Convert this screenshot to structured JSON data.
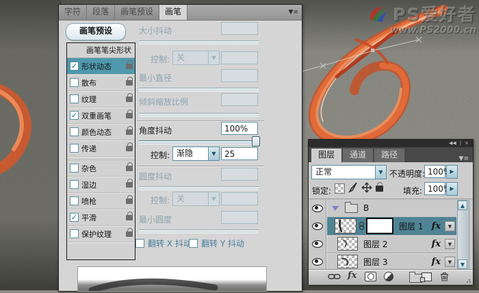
{
  "watermark": {
    "title": "PS爱好者",
    "url": "www.PS2000.cn"
  },
  "icons": {
    "check": "✓",
    "dropdown_arrow": "▼",
    "spinner_right": "▶",
    "scroll_up": "▲",
    "scroll_down": "▼",
    "collapse": "◀◀",
    "divider": "|",
    "close": "×",
    "panel_menu": "▼≡",
    "link": "∞"
  },
  "brush_panel": {
    "tabs": [
      {
        "label": "字符",
        "active": false
      },
      {
        "label": "段落",
        "active": false
      },
      {
        "label": "画笔预设",
        "active": false
      },
      {
        "label": "画笔",
        "active": true
      }
    ],
    "preset_button": "画笔预设",
    "tip_shape_header": "画笔笔尖形状",
    "options": [
      {
        "label": "形状动态",
        "checked": true,
        "selected": true
      },
      {
        "label": "散布",
        "checked": false,
        "selected": false
      },
      {
        "label": "纹理",
        "checked": false,
        "selected": false
      },
      {
        "label": "双重画笔",
        "checked": true,
        "selected": false
      },
      {
        "label": "颜色动态",
        "checked": false,
        "selected": false
      },
      {
        "label": "传递",
        "checked": false,
        "selected": false
      },
      {
        "label": "杂色",
        "checked": false,
        "selected": false
      },
      {
        "label": "湿边",
        "checked": false,
        "selected": false
      },
      {
        "label": "喷枪",
        "checked": false,
        "selected": false
      },
      {
        "label": "平滑",
        "checked": true,
        "selected": false
      },
      {
        "label": "保护纹理",
        "checked": false,
        "selected": false
      }
    ],
    "settings": {
      "size_jitter": {
        "label": "大小抖动",
        "value": "",
        "enabled": false
      },
      "control_size": {
        "label": "控制:",
        "value": "关",
        "enabled": false
      },
      "min_diameter": {
        "label": "最小直径",
        "value": "",
        "enabled": false
      },
      "tilt_scale": {
        "label": "倾斜缩放比例",
        "value": "",
        "enabled": false
      },
      "angle_jitter": {
        "label": "角度抖动",
        "value": "100%",
        "enabled": true
      },
      "control_angle": {
        "label": "控制:",
        "value": "渐隐",
        "fade_steps": "25",
        "enabled": true
      },
      "roundness_jitter": {
        "label": "圆度抖动",
        "value": "",
        "enabled": false
      },
      "control_roundness": {
        "label": "控制:",
        "value": "关",
        "enabled": false
      },
      "min_roundness": {
        "label": "最小圆度",
        "value": "",
        "enabled": false
      },
      "flip_x": {
        "label": "翻转 X 抖动",
        "checked": false
      },
      "flip_y": {
        "label": "翻转 Y 抖动",
        "checked": false
      }
    }
  },
  "layers_panel": {
    "tabs": [
      {
        "label": "图层",
        "active": true
      },
      {
        "label": "通道",
        "active": false
      },
      {
        "label": "路径",
        "active": false
      }
    ],
    "blend_mode": "正常",
    "opacity_label": "不透明度:",
    "opacity_value": "100%",
    "lock_label": "锁定:",
    "fill_label": "填充:",
    "fill_value": "100%",
    "fx_badge": "fx",
    "group": {
      "name": "B",
      "expanded": true
    },
    "layers": [
      {
        "name": "图层 1",
        "selected": true,
        "has_mask": true,
        "linked": true
      },
      {
        "name": "图层 2",
        "selected": false,
        "has_mask": false,
        "linked": false
      },
      {
        "name": "图层 3",
        "selected": false,
        "has_mask": false,
        "linked": false
      }
    ]
  },
  "colors": {
    "accent_teal": "#4f8494",
    "list_selection": "#4f98ad",
    "panel_bg": "#d5d5d5",
    "layers_panel_bg": "#cdcdcd",
    "artwork_orange": "#d96234",
    "background_concrete": "#8c8c84"
  }
}
